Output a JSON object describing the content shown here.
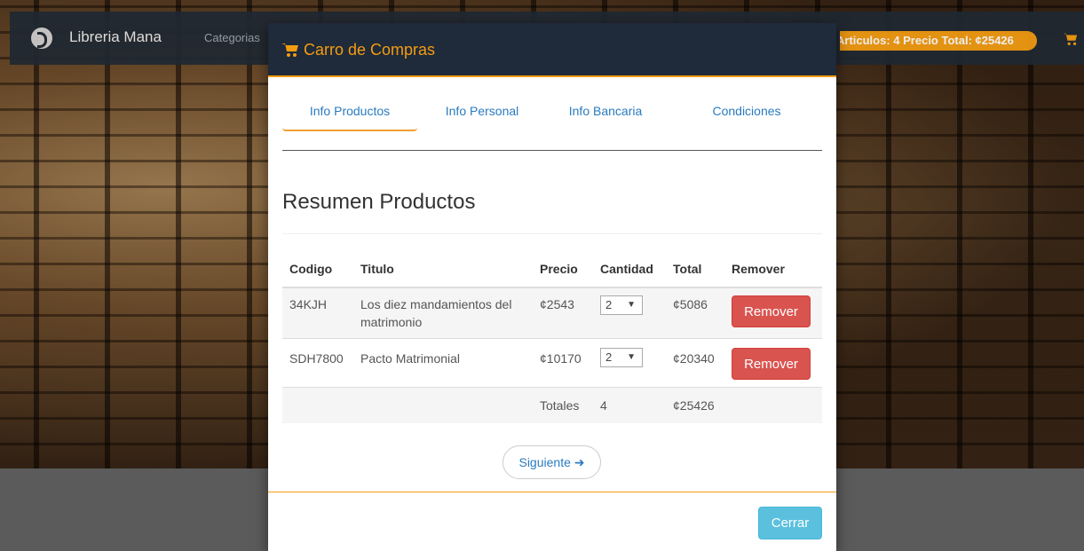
{
  "navbar": {
    "brand": "Libreria Mana",
    "categories_label": "Categorias",
    "cart_summary": "Articulos: 4 Precio Total: ¢25426"
  },
  "modal": {
    "title": "Carro de Compras",
    "tabs": [
      {
        "label": "Info Productos",
        "active": true
      },
      {
        "label": "Info Personal",
        "active": false
      },
      {
        "label": "Info Bancaria",
        "active": false
      },
      {
        "label": "Condiciones",
        "active": false
      }
    ],
    "section_title": "Resumen Productos",
    "table": {
      "headers": [
        "Codigo",
        "Titulo",
        "Precio",
        "Cantidad",
        "Total",
        "Remover"
      ],
      "rows": [
        {
          "codigo": "34KJH",
          "titulo": "Los diez mandamientos del matrimonio",
          "precio": "¢2543",
          "cantidad": "2",
          "total": "¢5086",
          "remove_label": "Remover"
        },
        {
          "codigo": "SDH7800",
          "titulo": "Pacto Matrimonial",
          "precio": "¢10170",
          "cantidad": "2",
          "total": "¢20340",
          "remove_label": "Remover"
        }
      ],
      "totals": {
        "label": "Totales",
        "cantidad": "4",
        "total": "¢25426"
      }
    },
    "next_label": "Siguiente",
    "close_label": "Cerrar"
  },
  "colors": {
    "accent": "#f39c12",
    "header": "#1f2a3a",
    "danger": "#d9534f",
    "info": "#5bc0de",
    "link": "#2a7bbf"
  }
}
